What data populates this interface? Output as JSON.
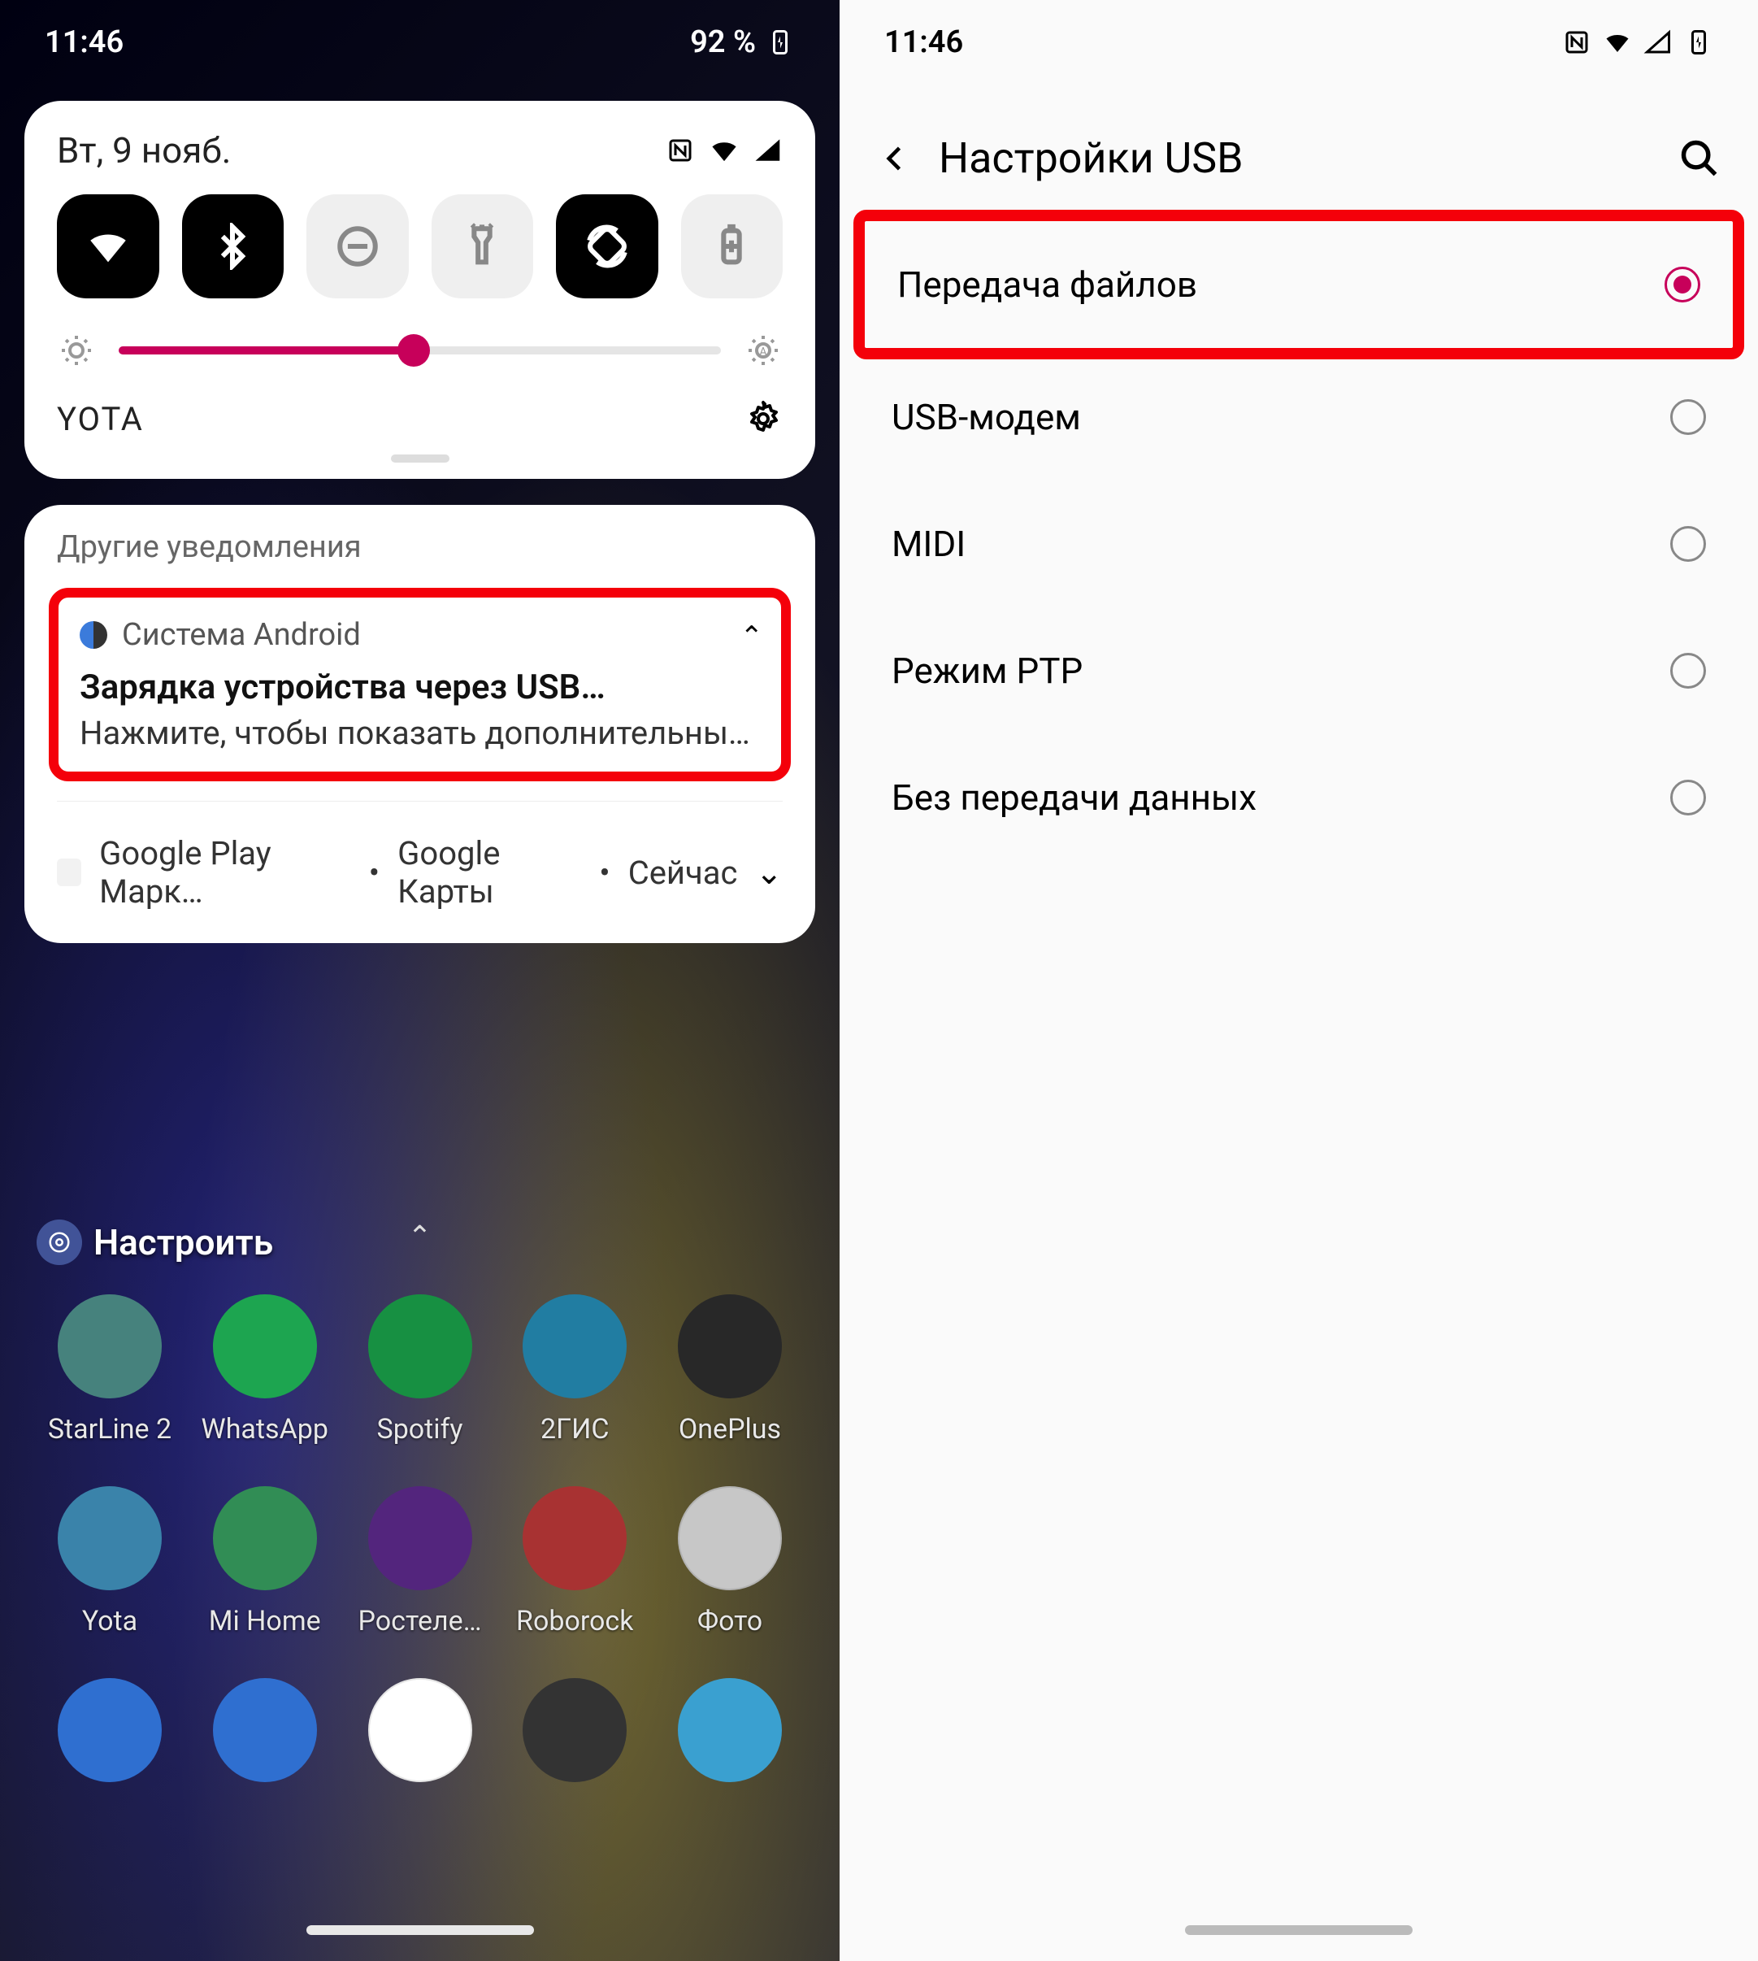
{
  "left": {
    "status": {
      "time": "11:46",
      "battery": "92 %"
    },
    "qs": {
      "date": "Вт, 9 нояб.",
      "brightness_pct": 49,
      "carrier": "YOTA"
    },
    "notifications": {
      "header": "Другие уведомления",
      "usb": {
        "app": "Система Android",
        "title": "Зарядка устройства через USB…",
        "body": "Нажмите, чтобы показать дополнительны…"
      },
      "group": {
        "a": "Google Play Марк…",
        "b": "Google Карты",
        "c": "Сейчас"
      }
    },
    "customize": "Настроить",
    "apps_row1": [
      {
        "label": "StarLine 2",
        "bg": "#5aa7a0"
      },
      {
        "label": "WhatsApp",
        "bg": "#25d366"
      },
      {
        "label": "Spotify",
        "bg": "#1db954"
      },
      {
        "label": "2ГИС",
        "bg": "#2aa0d0"
      },
      {
        "label": "OnePlus",
        "bg": "#333333"
      }
    ],
    "apps_row2": [
      {
        "label": "Yota",
        "bg": "#4aa8da"
      },
      {
        "label": "Mi Home",
        "bg": "#3fb56d"
      },
      {
        "label": "Ростеле…",
        "bg": "#6b2fa0"
      },
      {
        "label": "Roborock",
        "bg": "#d84040"
      },
      {
        "label": "Фото",
        "bg": "#ffffff"
      }
    ],
    "dock": [
      {
        "bg": "#2f6fd0"
      },
      {
        "bg": "#2f6fd0"
      },
      {
        "bg": "#ffffff"
      },
      {
        "bg": "#333333"
      },
      {
        "bg": "#3aa0d0"
      }
    ]
  },
  "right": {
    "status": {
      "time": "11:46"
    },
    "title": "Настройки USB",
    "options": [
      {
        "label": "Передача файлов",
        "selected": true,
        "highlighted": true
      },
      {
        "label": "USB-модем",
        "selected": false,
        "highlighted": false
      },
      {
        "label": "MIDI",
        "selected": false,
        "highlighted": false
      },
      {
        "label": "Режим PTP",
        "selected": false,
        "highlighted": false
      },
      {
        "label": "Без передачи данных",
        "selected": false,
        "highlighted": false
      }
    ]
  }
}
